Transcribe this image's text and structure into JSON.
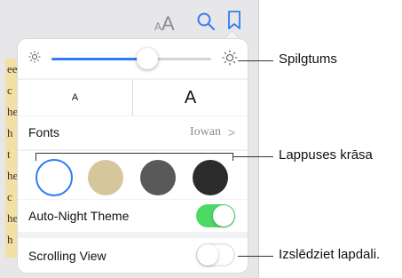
{
  "page_text_fragments": [
    "ee",
    "c",
    "he",
    "h",
    "t",
    "he",
    "c",
    "he",
    "h"
  ],
  "toolbar": {
    "font_size_small": "A",
    "font_size_large": "A",
    "search_icon": "search-icon",
    "bookmark_icon": "bookmark-icon"
  },
  "brightness": {
    "level": 0.6
  },
  "font_size": {
    "smaller_label": "A",
    "larger_label": "A"
  },
  "fonts": {
    "label": "Fonts",
    "value": "Iowan",
    "chevron": ">"
  },
  "page_colors": [
    "#ffffff",
    "#d6c69b",
    "#595959",
    "#2b2b2b"
  ],
  "auto_night": {
    "label": "Auto-Night Theme",
    "on": true
  },
  "scrolling_view": {
    "label": "Scrolling View",
    "on": false
  },
  "callouts": {
    "brightness": "Spilgtums",
    "page_color": "Lappuses krāsa",
    "scrolling": "Izslēdziet lapdali."
  },
  "colors": {
    "accent": "#2f7cf6",
    "toggle_on": "#4cd964"
  }
}
